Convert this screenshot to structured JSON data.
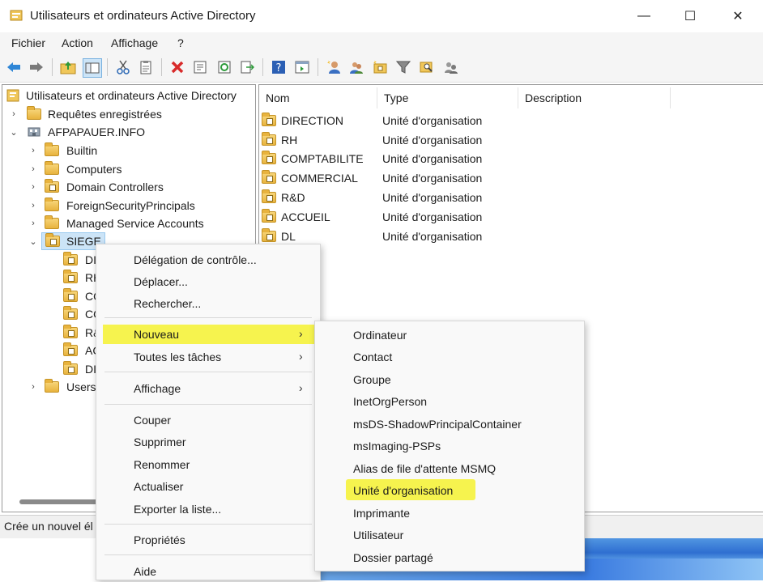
{
  "window": {
    "title": "Utilisateurs et ordinateurs Active Directory",
    "controls": {
      "minimize": "—",
      "maximize": "☐",
      "close": "✕"
    }
  },
  "menubar": [
    "Fichier",
    "Action",
    "Affichage",
    "?"
  ],
  "toolbar": {
    "icons": [
      "back-arrow-icon",
      "forward-arrow-icon",
      "up-folder-icon",
      "show-tree-icon",
      "cut-icon",
      "clipboard-icon",
      "delete-icon",
      "properties-icon",
      "refresh-icon",
      "export-icon",
      "help-icon",
      "console-icon",
      "new-user-icon",
      "new-group-icon",
      "new-ou-icon",
      "filter-icon",
      "find-icon",
      "add-to-group-icon"
    ]
  },
  "tree": {
    "root": "Utilisateurs et ordinateurs Active Directory",
    "saved_queries": "Requêtes enregistrées",
    "domain": "AFPAPAUER.INFO",
    "children": [
      "Builtin",
      "Computers",
      "Domain Controllers",
      "ForeignSecurityPrincipals",
      "Managed Service Accounts"
    ],
    "selected": "SIEGE",
    "siege_children_partial": [
      "DI",
      "RH",
      "CO",
      "CO",
      "R&",
      "AC",
      "DI"
    ],
    "users": "Users"
  },
  "list": {
    "columns": [
      "Nom",
      "Type",
      "Description"
    ],
    "rows": [
      {
        "name": "DIRECTION",
        "type": "Unité d'organisation"
      },
      {
        "name": "RH",
        "type": "Unité d'organisation"
      },
      {
        "name": "COMPTABILITE",
        "type": "Unité d'organisation"
      },
      {
        "name": "COMMERCIAL",
        "type": "Unité d'organisation"
      },
      {
        "name": "R&D",
        "type": "Unité d'organisation"
      },
      {
        "name": "ACCUEIL",
        "type": "Unité d'organisation"
      },
      {
        "name": "DL",
        "type": "Unité d'organisation"
      }
    ]
  },
  "status": "Crée un nouvel él",
  "context_menu": {
    "group1": [
      "Délégation de contrôle...",
      "Déplacer...",
      "Rechercher..."
    ],
    "new": "Nouveau",
    "all_tasks": "Toutes les tâches",
    "view": "Affichage",
    "group3": [
      "Couper",
      "Supprimer",
      "Renommer",
      "Actualiser",
      "Exporter la liste..."
    ],
    "properties": "Propriétés",
    "help": "Aide",
    "submenu_arrow": "›"
  },
  "submenu": {
    "items": [
      "Ordinateur",
      "Contact",
      "Groupe",
      "InetOrgPerson",
      "msDS-ShadowPrincipalContainer",
      "msImaging-PSPs",
      "Alias de file d'attente MSMQ",
      "Unité d'organisation",
      "Imprimante",
      "Utilisateur",
      "Dossier partagé"
    ],
    "highlighted": "Unité d'organisation"
  },
  "colors": {
    "highlight": "#f6f230",
    "selection": "#cce4f7"
  }
}
